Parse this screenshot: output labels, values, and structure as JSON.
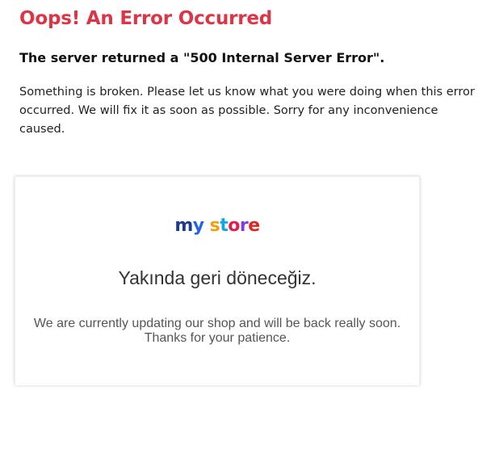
{
  "error": {
    "title": "Oops! An Error Occurred",
    "subtitle": "The server returned a \"500 Internal Server Error\".",
    "message": "Something is broken. Please let us know what you were doing when this error occurred. We will fix it as soon as possible. Sorry for any inconvenience caused."
  },
  "maintenance": {
    "logo_text": "my store",
    "logo_colors": [
      "#1e3a8a",
      "#2563eb",
      "#f59e0b",
      "#0ea5e9",
      "#e11d48",
      "#7c3aed",
      "#dc2626"
    ],
    "heading": "Yakında geri döneceğiz.",
    "line1": "We are currently updating our shop and will be back really soon.",
    "line2": "Thanks for your patience."
  },
  "colors": {
    "error_title": "#dc3545"
  }
}
